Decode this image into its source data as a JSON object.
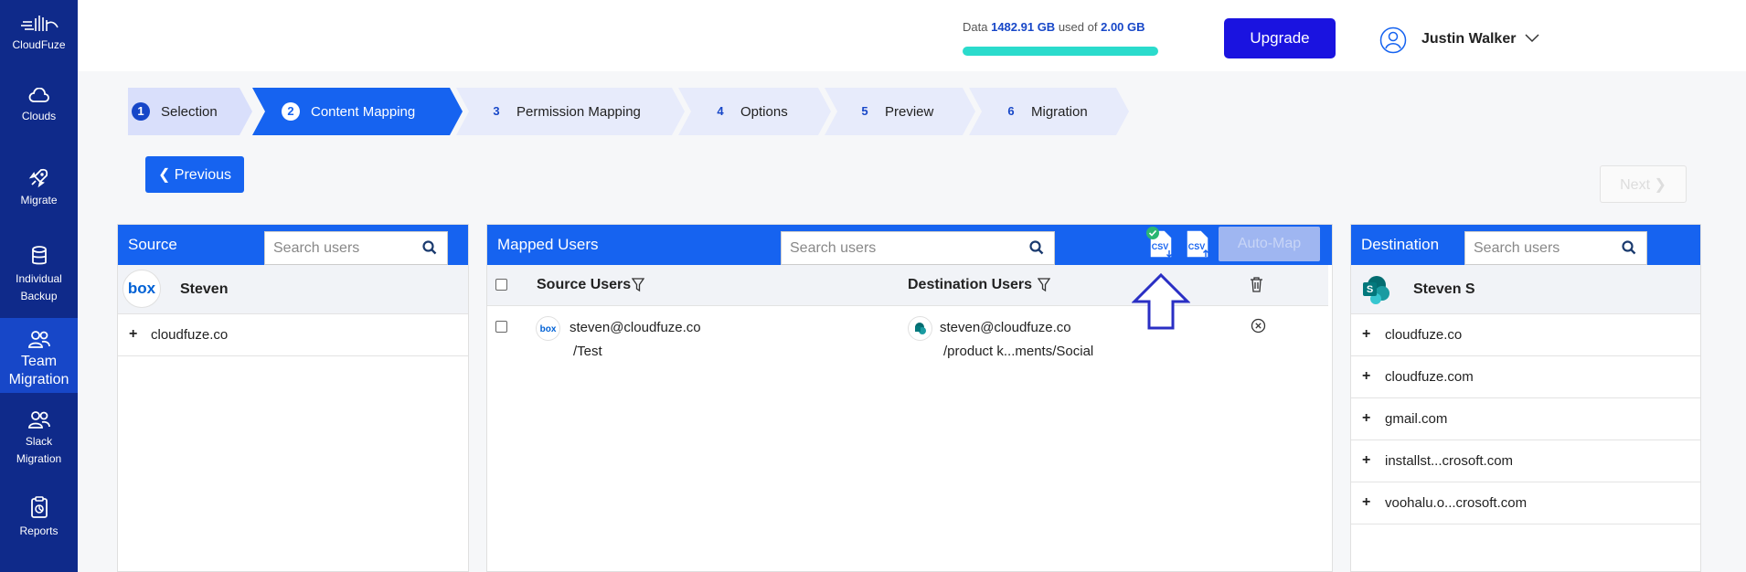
{
  "sidebar": {
    "logo_label": "CloudFuze",
    "items": [
      {
        "label": "Clouds",
        "icon": "cloud-icon"
      },
      {
        "label": "Migrate",
        "icon": "rocket-icon"
      },
      {
        "label": "Individual Backup",
        "icon": "database-icon"
      },
      {
        "label": "Team Migration",
        "icon": "team-icon",
        "active": true
      },
      {
        "label": "Slack Migration",
        "icon": "team-icon"
      },
      {
        "label": "Reports",
        "icon": "clipboard-icon"
      }
    ]
  },
  "topbar": {
    "usage_prefix": "Data",
    "usage_used": "1482.91 GB",
    "usage_mid": "used of",
    "usage_total": "2.00 GB",
    "upgrade_label": "Upgrade",
    "user_name": "Justin Walker"
  },
  "steps": [
    {
      "num": "1",
      "label": "Selection"
    },
    {
      "num": "2",
      "label": "Content Mapping"
    },
    {
      "num": "3",
      "label": "Permission Mapping"
    },
    {
      "num": "4",
      "label": "Options"
    },
    {
      "num": "5",
      "label": "Preview"
    },
    {
      "num": "6",
      "label": "Migration"
    }
  ],
  "nav": {
    "previous_label": "Previous",
    "next_label": "Next"
  },
  "source": {
    "title": "Source",
    "search_placeholder": "Search users",
    "user_name": "Steven",
    "domains": [
      "cloudfuze.co"
    ]
  },
  "mapped": {
    "title": "Mapped Users",
    "search_placeholder": "Search users",
    "automap_label": "Auto-Map",
    "col_source": "Source Users",
    "col_destination": "Destination Users",
    "rows": [
      {
        "source_email": "steven@cloudfuze.co",
        "source_path": "/Test",
        "dest_email": "steven@cloudfuze.co",
        "dest_path": "/product k...ments/Social"
      }
    ]
  },
  "destination": {
    "title": "Destination",
    "search_placeholder": "Search users",
    "user_name": "Steven S",
    "domains": [
      "cloudfuze.co",
      "cloudfuze.com",
      "gmail.com",
      "installst...crosoft.com",
      "voohalu.o...crosoft.com"
    ]
  },
  "colors": {
    "sidebar": "#0f2a8a",
    "sidebar_active": "#1747c8",
    "primary": "#1663f0",
    "upgrade": "#1a13e0",
    "usage_bar": "#2bdbcc"
  }
}
